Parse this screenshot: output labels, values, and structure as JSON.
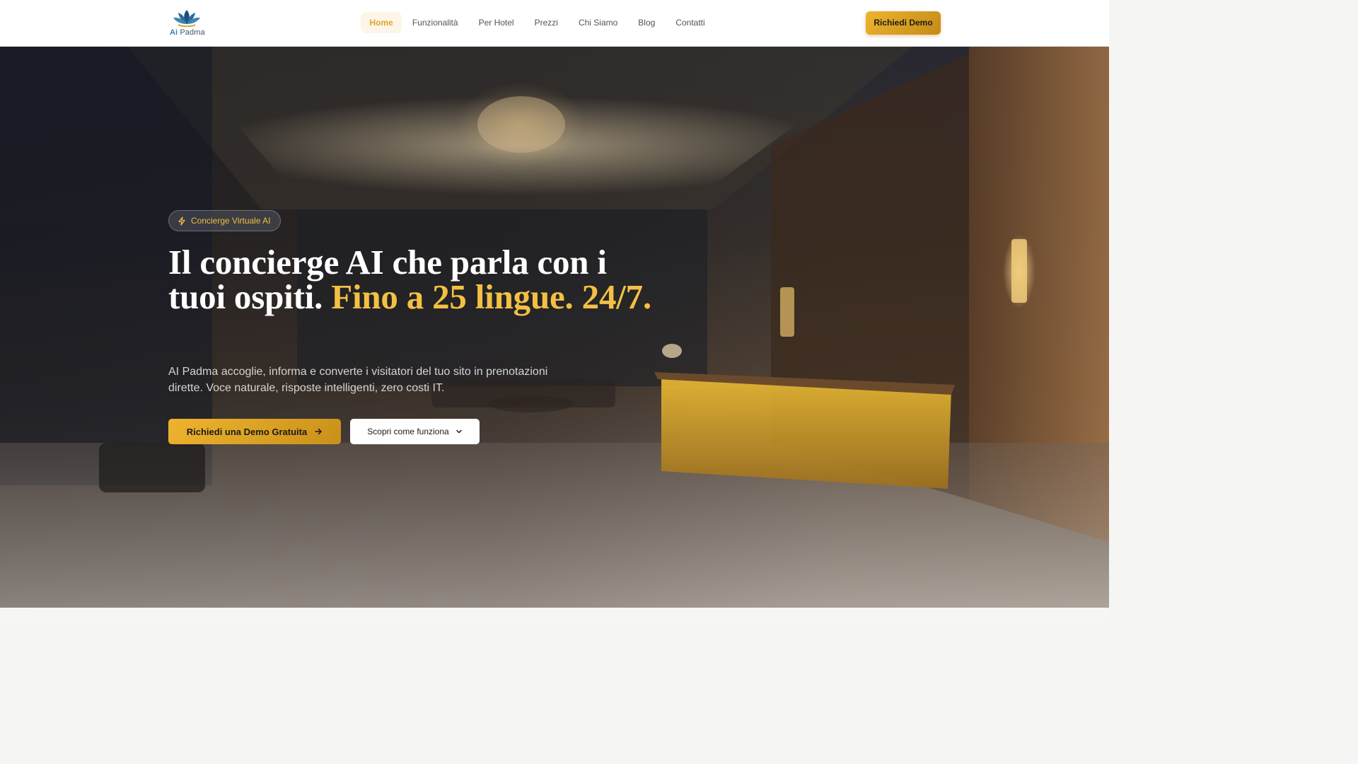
{
  "brand": {
    "logo_prefix": "Ai",
    "logo_name": "Padma"
  },
  "nav": {
    "items": [
      {
        "label": "Home",
        "active": true
      },
      {
        "label": "Funzionalità",
        "active": false
      },
      {
        "label": "Per Hotel",
        "active": false
      },
      {
        "label": "Prezzi",
        "active": false
      },
      {
        "label": "Chi Siamo",
        "active": false
      },
      {
        "label": "Blog",
        "active": false
      },
      {
        "label": "Contatti",
        "active": false
      }
    ],
    "cta_label": "Richiedi Demo"
  },
  "hero": {
    "badge": {
      "icon": "lightning-icon",
      "label": "Concierge Virtuale AI"
    },
    "headline_white": "Il concierge AI che parla con i tuoi ospiti.",
    "headline_gold": "Fino a 25 lingue. 24/7.",
    "subtitle": "AI Padma accoglie, informa e converte i visitatori del tuo sito in prenotazioni dirette. Voce naturale, risposte intelligenti, zero costi IT.",
    "primary_cta": {
      "label": "Richiedi una Demo Gratuita",
      "icon": "arrow-right-icon"
    },
    "secondary_cta": {
      "label": "Scopri come funziona",
      "icon": "chevron-down-icon"
    }
  },
  "colors": {
    "accent": "#f2c043",
    "accent_dark": "#c48a17",
    "nav_active_bg": "#fdf5e8",
    "text_dark": "#1c1917"
  }
}
